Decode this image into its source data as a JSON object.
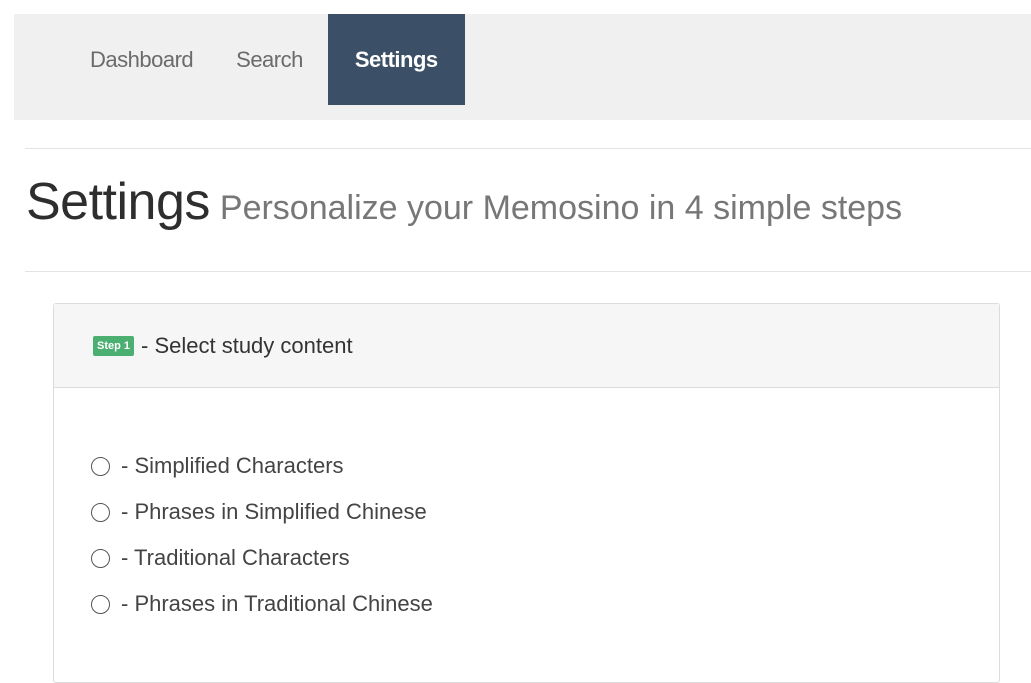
{
  "nav": {
    "items": [
      {
        "label": "Dashboard",
        "active": false
      },
      {
        "label": "Search",
        "active": false
      },
      {
        "label": "Settings",
        "active": true
      }
    ]
  },
  "header": {
    "title": "Settings",
    "subtitle": "Personalize your Memosino in 4 simple steps"
  },
  "step1": {
    "badge": "Step 1",
    "heading": " - Select study content",
    "options": [
      {
        "label": "- Simplified Characters",
        "selected": false
      },
      {
        "label": "- Phrases in Simplified Chinese",
        "selected": false
      },
      {
        "label": "- Traditional Characters",
        "selected": false
      },
      {
        "label": "- Phrases in Traditional Chinese",
        "selected": false
      }
    ]
  },
  "colors": {
    "nav_active_bg": "#3b5067",
    "nav_bg": "#f0f0f0",
    "badge_bg": "#4caf72"
  },
  "icons": {
    "radio": "radio-unchecked-icon"
  }
}
